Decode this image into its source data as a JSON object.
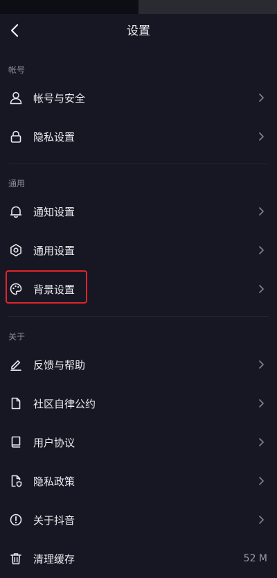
{
  "header": {
    "title": "设置"
  },
  "sections": {
    "account": "帐号",
    "general": "通用",
    "about": "关于"
  },
  "items": {
    "account_security": "帐号与安全",
    "privacy_settings": "隐私设置",
    "notification_settings": "通知设置",
    "general_settings": "通用设置",
    "background_settings": "背景设置",
    "feedback_help": "反馈与帮助",
    "community_rules": "社区自律公约",
    "user_agreement": "用户协议",
    "privacy_policy": "隐私政策",
    "about_douyin": "关于抖音",
    "clear_cache": "清理缓存",
    "cache_size": "52 M"
  },
  "colors": {
    "background": "#171723",
    "highlight_border": "#e2242a"
  }
}
